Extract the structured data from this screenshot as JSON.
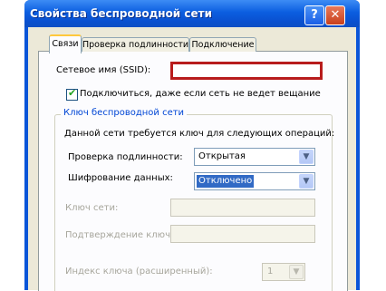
{
  "window": {
    "title": "Свойства беспроводной сети",
    "help_glyph": "?",
    "close_glyph": "✕"
  },
  "tabs": [
    {
      "label": "Связи",
      "selected": true
    },
    {
      "label": "Проверка подлинности",
      "selected": false
    },
    {
      "label": "Подключение",
      "selected": false
    }
  ],
  "form": {
    "ssid_label": "Сетевое имя (SSID):",
    "ssid_value": "",
    "broadcast_checkbox_label": "Подключиться, даже если сеть не ведет вещание",
    "broadcast_checked": true,
    "checkmark": "✔",
    "group_title": "Ключ беспроводной сети",
    "group_description": "Данной сети требуется ключ для следующих операций:",
    "auth_label": "Проверка подлинности:",
    "auth_value": "Открытая",
    "encryption_label": "Шифрование данных:",
    "encryption_value": "Отключено",
    "network_key_label": "Ключ сети:",
    "confirm_key_label": "Подтверждение ключа:",
    "key_index_label": "Индекс ключа (расширенный):",
    "key_index_value": "1",
    "dropdown_arrow": "▼"
  },
  "colors": {
    "titlebar": "#0b5ee0",
    "ssid_highlight": "#b81c1c",
    "selection": "#316ac5",
    "group_title": "#0046d5"
  }
}
